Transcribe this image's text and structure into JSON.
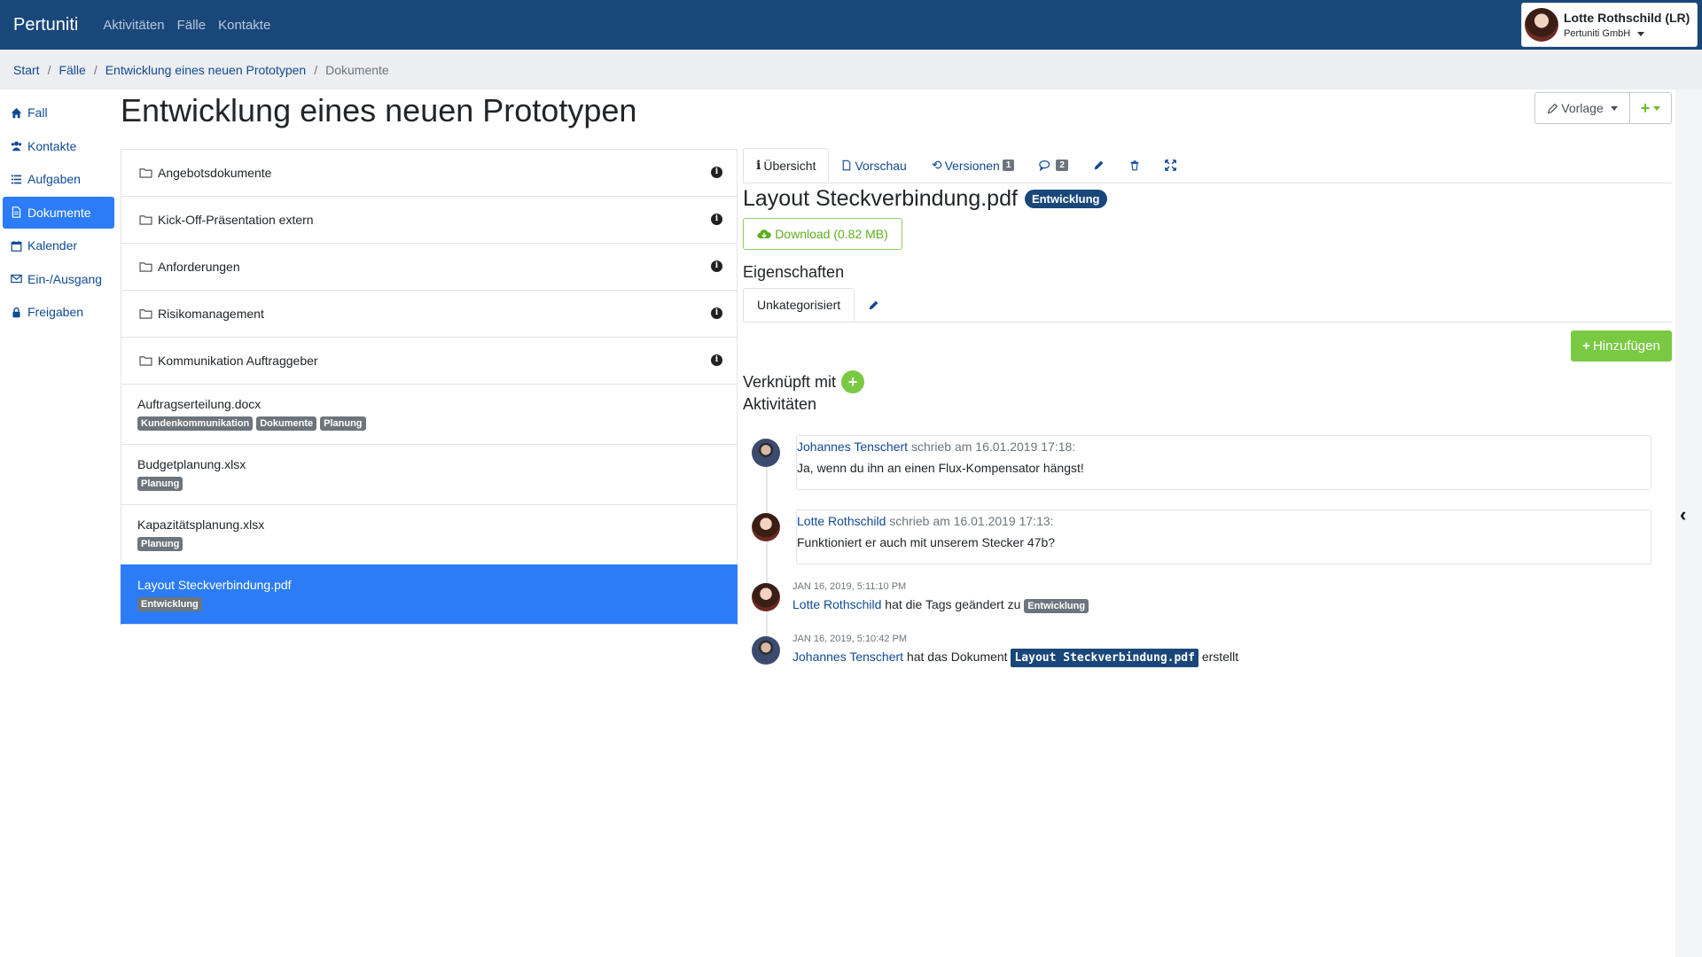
{
  "navbar": {
    "brand": "Pertuniti",
    "links": [
      "Aktivitäten",
      "Fälle",
      "Kontakte"
    ],
    "user_name": "Lotte Rothschild (LR)",
    "user_org": "Pertuniti GmbH"
  },
  "breadcrumb": [
    "Start",
    "Fälle",
    "Entwicklung eines neuen Prototypen",
    "Dokumente"
  ],
  "sidebar": {
    "items": [
      {
        "label": "Fall",
        "icon": "home-icon"
      },
      {
        "label": "Kontakte",
        "icon": "users-icon"
      },
      {
        "label": "Aufgaben",
        "icon": "list-icon"
      },
      {
        "label": "Dokumente",
        "icon": "document-icon",
        "active": true
      },
      {
        "label": "Kalender",
        "icon": "calendar-icon"
      },
      {
        "label": "Ein-/Ausgang",
        "icon": "envelope-icon"
      },
      {
        "label": "Freigaben",
        "icon": "lock-icon"
      }
    ]
  },
  "page": {
    "title": "Entwicklung eines neuen Prototypen",
    "vorlage_label": "Vorlage",
    "plus_label": "+"
  },
  "folders": [
    "Angebotsdokumente",
    "Kick-Off-Präsentation extern",
    "Anforderungen",
    "Risikomanagement",
    "Kommunikation Auftraggeber"
  ],
  "files": [
    {
      "name": "Auftragserteilung.docx",
      "tags": [
        "Kundenkommunikation",
        "Dokumente",
        "Planung"
      ]
    },
    {
      "name": "Budgetplanung.xlsx",
      "tags": [
        "Planung"
      ]
    },
    {
      "name": "Kapazitätsplanung.xlsx",
      "tags": [
        "Planung"
      ]
    },
    {
      "name": "Layout Steckverbindung.pdf",
      "tags": [
        "Entwicklung"
      ],
      "active": true
    }
  ],
  "detail": {
    "tabs": {
      "uebersicht": "Übersicht",
      "vorschau": "Vorschau",
      "versionen": "Versionen",
      "versionen_count": "1",
      "comments_count": "2"
    },
    "title": "Layout Steckverbindung.pdf",
    "badge": "Entwicklung",
    "download": "Download (0.82 MB)",
    "eigenschaften": "Eigenschaften",
    "subtab": "Unkategorisiert",
    "hinzufuegen": "Hinzufügen",
    "verknuepft": "Verknüpft mit",
    "aktivitaeten": "Aktivitäten"
  },
  "activities": {
    "c1": {
      "author": "Johannes Tenschert",
      "meta": " schrieb am 16.01.2019 17:18:",
      "text": "Ja, wenn du ihn an einen Flux-Kompensator hängst!"
    },
    "c2": {
      "author": "Lotte Rothschild",
      "meta": " schrieb am 16.01.2019 17:13:",
      "text": "Funktioniert er auch mit unserem Stecker 47b?"
    },
    "e1": {
      "time": "JAN 16, 2019, 5:11:10 PM",
      "author": "Lotte Rothschild",
      "text": " hat die Tags geändert zu ",
      "tag": "Entwicklung"
    },
    "e2": {
      "time": "JAN 16, 2019, 5:10:42 PM",
      "author": "Johannes Tenschert",
      "text": " hat das Dokument ",
      "tag": "Layout Steckverbindung.pdf",
      "suffix": " erstellt"
    }
  }
}
